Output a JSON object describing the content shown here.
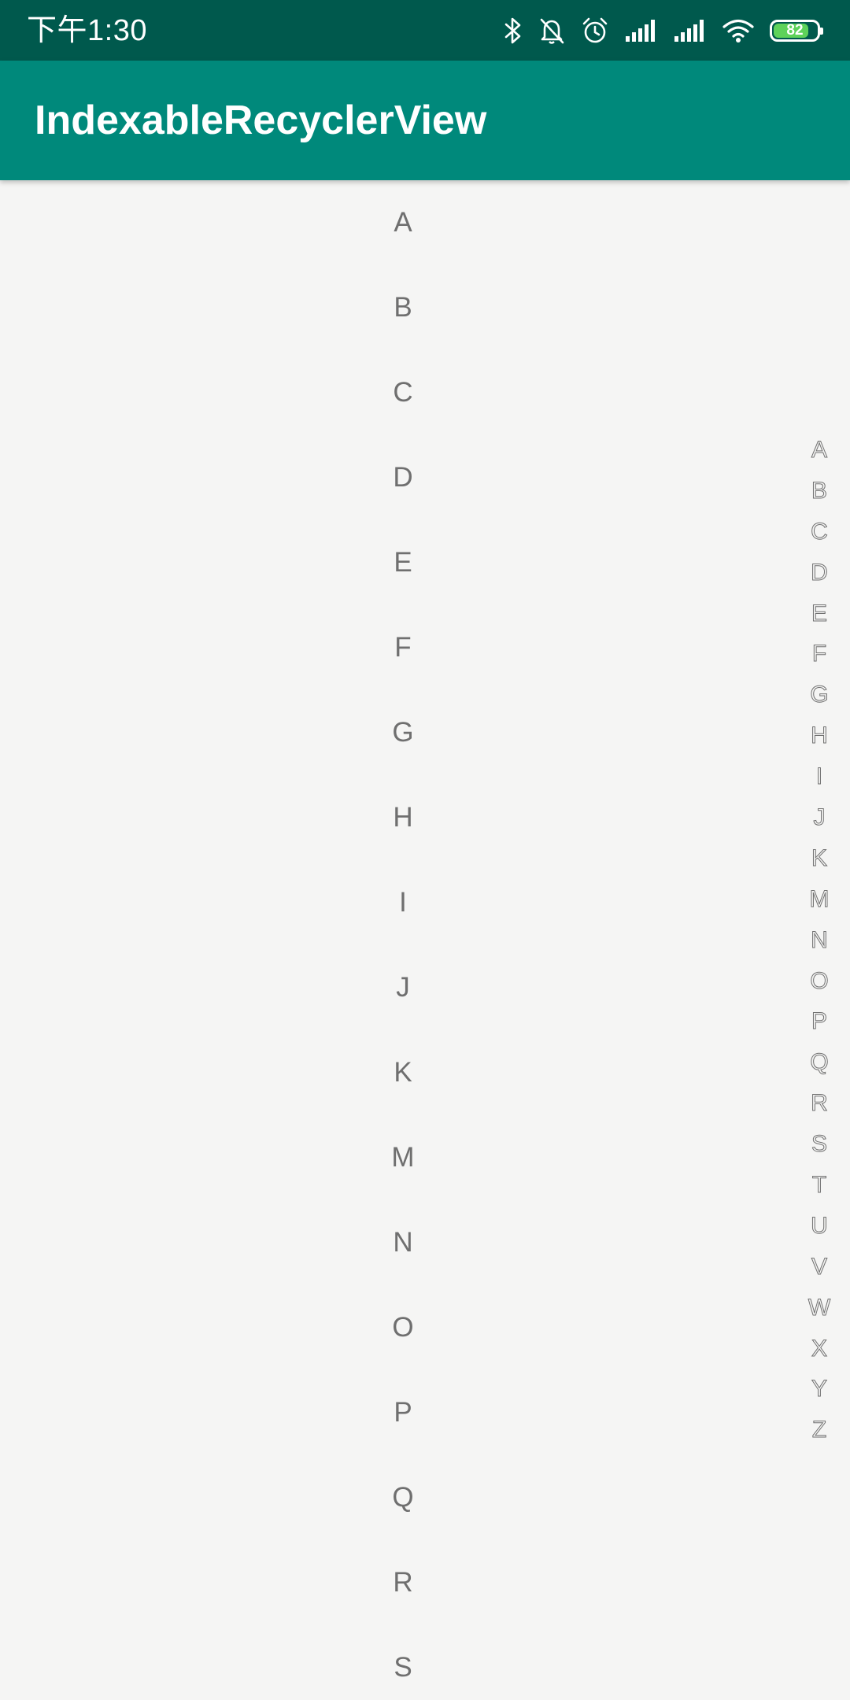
{
  "status_bar": {
    "time": "下午1:30",
    "battery_level": "82",
    "battery_fraction": 0.82,
    "icons": [
      "bluetooth-icon",
      "silent-bell-icon",
      "alarm-icon",
      "signal-icon",
      "signal-icon",
      "wifi-icon",
      "battery-icon"
    ]
  },
  "app_bar": {
    "title": "IndexableRecyclerView"
  },
  "list": {
    "items": [
      "A",
      "B",
      "C",
      "D",
      "E",
      "F",
      "G",
      "H",
      "I",
      "J",
      "K",
      "M",
      "N",
      "O",
      "P",
      "Q",
      "R",
      "S"
    ]
  },
  "index_bar": {
    "letters": [
      "A",
      "B",
      "C",
      "D",
      "E",
      "F",
      "G",
      "H",
      "I",
      "J",
      "K",
      "M",
      "N",
      "O",
      "P",
      "Q",
      "R",
      "S",
      "T",
      "U",
      "V",
      "W",
      "X",
      "Y",
      "Z"
    ]
  },
  "colors": {
    "status_bar": "#00594d",
    "app_bar": "#00897b",
    "background": "#f5f5f4",
    "list_text": "#6f6f6f",
    "battery_fill": "#5ed25a"
  }
}
